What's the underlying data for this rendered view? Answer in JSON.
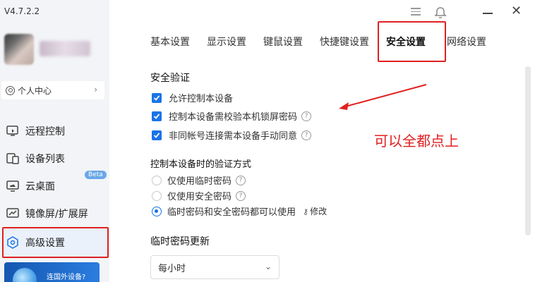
{
  "app": {
    "version": "V4.7.2.2"
  },
  "sidebar": {
    "personal_center": "个人中心",
    "items": [
      {
        "label": "远程控制",
        "icon": "remote-control-icon"
      },
      {
        "label": "设备列表",
        "icon": "device-list-icon"
      },
      {
        "label": "云桌面",
        "icon": "cloud-desktop-icon",
        "badge": "Beta"
      },
      {
        "label": "镜像屏/扩展屏",
        "icon": "mirror-screen-icon"
      },
      {
        "label": "高级设置",
        "icon": "advanced-settings-icon"
      }
    ],
    "promo": "连国外设备?"
  },
  "tabs": [
    "基本设置",
    "显示设置",
    "键鼠设置",
    "快捷键设置",
    "安全设置",
    "网络设置"
  ],
  "active_tab": "安全设置",
  "security": {
    "title": "安全验证",
    "checks": [
      {
        "label": "允许控制本设备",
        "checked": true,
        "help": false
      },
      {
        "label": "控制本设备需校验本机锁屏密码",
        "checked": true,
        "help": true
      },
      {
        "label": "非同帐号连接需本设备手动同意",
        "checked": true,
        "help": true
      }
    ]
  },
  "verify": {
    "title": "控制本设备时的验证方式",
    "options": [
      {
        "label": "仅使用临时密码",
        "selected": false
      },
      {
        "label": "仅使用安全密码",
        "selected": false
      },
      {
        "label": "临时密码和安全密码都可以使用",
        "selected": true
      }
    ],
    "modify_label": "修改"
  },
  "temp_password": {
    "title": "临时密码更新",
    "value": "每小时"
  },
  "annotation": "可以全都点上",
  "colors": {
    "accent": "#1a73e8",
    "highlight": "#e02020"
  }
}
